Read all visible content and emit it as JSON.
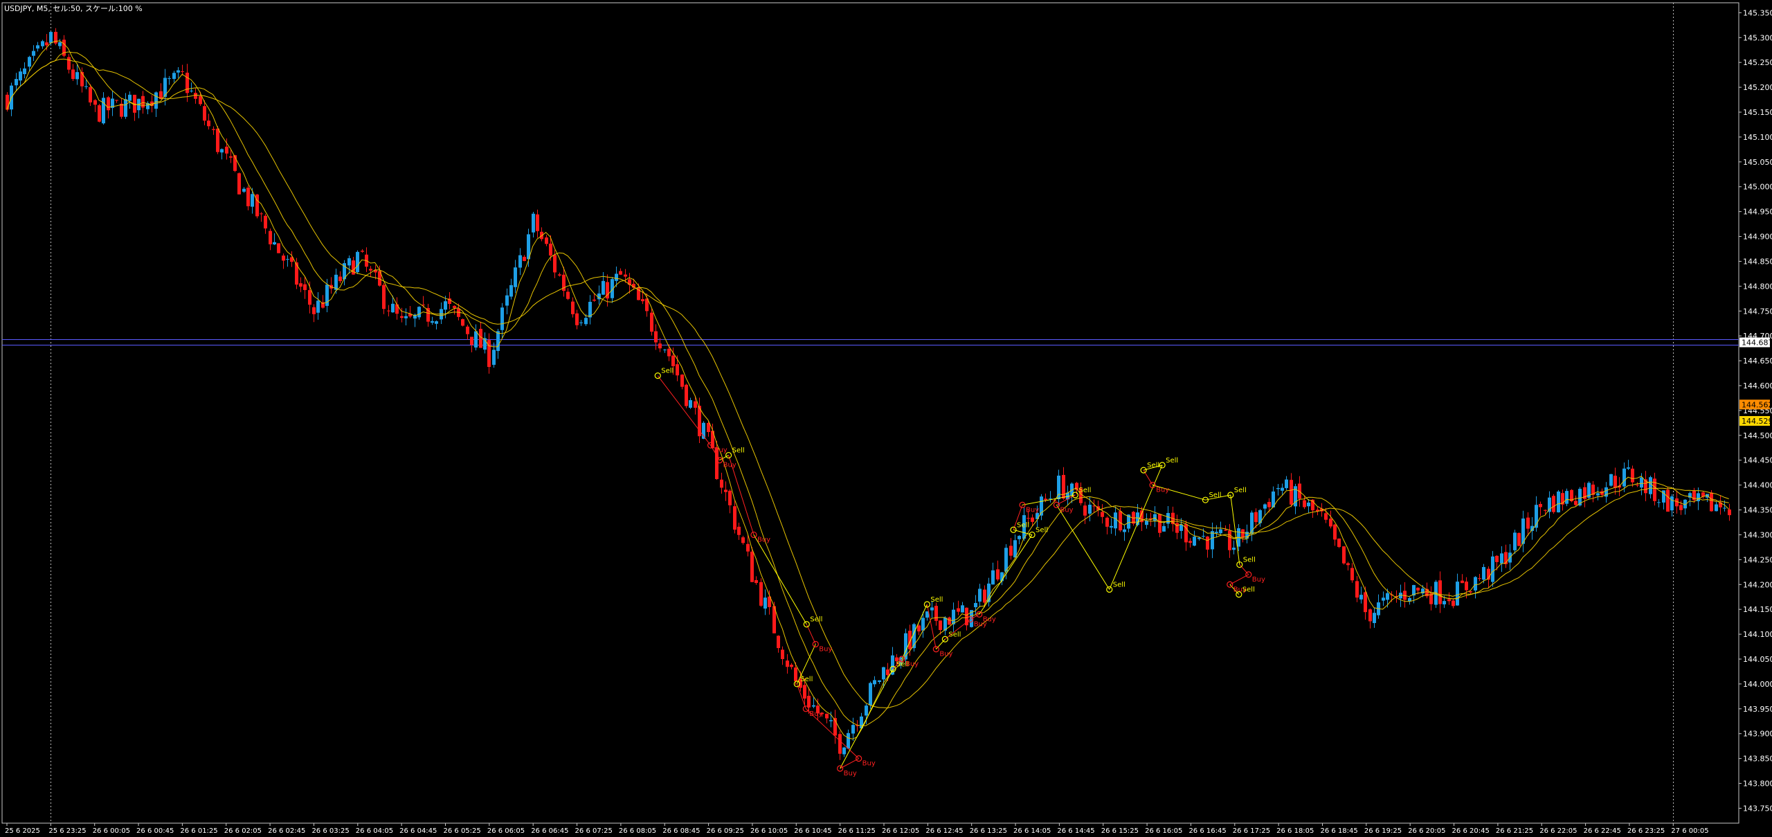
{
  "header": {
    "text": "USDJPY, M5, セル:50, スケール:100 %"
  },
  "colors": {
    "background": "#000000",
    "frame": "#c8c8c8",
    "bull": "#1e9fe6",
    "bear": "#ff1a1a",
    "ma": "#e6c300",
    "bid_line": "#5a5aff",
    "marker_sell": "#ffff00",
    "marker_buy": "#ff2020"
  },
  "price_labels": {
    "bid": "144.687",
    "level_a": "144.562",
    "level_b": "144.529"
  },
  "chart_data": {
    "type": "candlestick",
    "symbol": "USDJPY",
    "timeframe": "M5",
    "ylim": [
      143.72,
      145.37
    ],
    "yticks": [
      "145.350",
      "145.300",
      "145.250",
      "145.200",
      "145.150",
      "145.100",
      "145.050",
      "145.000",
      "144.950",
      "144.900",
      "144.850",
      "144.800",
      "144.750",
      "144.700",
      "144.650",
      "144.600",
      "144.550",
      "144.500",
      "144.450",
      "144.400",
      "144.350",
      "144.300",
      "144.250",
      "144.200",
      "144.150",
      "144.100",
      "144.050",
      "144.000",
      "143.950",
      "143.900",
      "143.850",
      "143.800",
      "143.750"
    ],
    "xticks": [
      "25 6 2025",
      "25 6 23:25",
      "26 6 00:05",
      "26 6 00:45",
      "26 6 01:25",
      "26 6 02:05",
      "26 6 02:45",
      "26 6 03:25",
      "26 6 04:05",
      "26 6 04:45",
      "26 6 05:25",
      "26 6 06:05",
      "26 6 06:45",
      "26 6 07:25",
      "26 6 08:05",
      "26 6 08:45",
      "26 6 09:25",
      "26 6 10:05",
      "26 6 10:45",
      "26 6 11:25",
      "26 6 12:05",
      "26 6 12:45",
      "26 6 13:25",
      "26 6 14:05",
      "26 6 14:45",
      "26 6 15:25",
      "26 6 16:05",
      "26 6 16:45",
      "26 6 17:25",
      "26 6 18:05",
      "26 6 18:45",
      "26 6 19:25",
      "26 6 20:05",
      "26 6 20:45",
      "26 6 21:25",
      "26 6 22:05",
      "26 6 22:45",
      "26 6 23:25",
      "27 6 00:05"
    ],
    "bid_price": 144.687,
    "levels": [
      144.562,
      144.529
    ],
    "period_separators": [
      "25 6 23:25",
      "27 6 00:05"
    ],
    "close_path": [
      [
        "25 6 2025",
        145.18
      ],
      [
        "25 6 23:25",
        145.3
      ],
      [
        "26 6 00:05",
        145.15
      ],
      [
        "26 6 00:45",
        145.17
      ],
      [
        "26 6 01:25",
        145.22
      ],
      [
        "26 6 02:05",
        145.05
      ],
      [
        "26 6 02:45",
        144.9
      ],
      [
        "26 6 03:25",
        144.75
      ],
      [
        "26 6 04:05",
        144.86
      ],
      [
        "26 6 04:45",
        144.72
      ],
      [
        "26 6 05:25",
        144.76
      ],
      [
        "26 6 06:05",
        144.66
      ],
      [
        "26 6 06:45",
        144.93
      ],
      [
        "26 6 07:25",
        144.74
      ],
      [
        "26 6 08:05",
        144.82
      ],
      [
        "26 6 08:45",
        144.68
      ],
      [
        "26 6 09:25",
        144.48
      ],
      [
        "26 6 10:05",
        144.22
      ],
      [
        "26 6 10:45",
        144.0
      ],
      [
        "26 6 11:25",
        143.88
      ],
      [
        "26 6 12:05",
        144.03
      ],
      [
        "26 6 12:45",
        144.13
      ],
      [
        "26 6 13:25",
        144.14
      ],
      [
        "26 6 14:05",
        144.3
      ],
      [
        "26 6 14:45",
        144.4
      ],
      [
        "26 6 15:25",
        144.33
      ],
      [
        "26 6 16:05",
        144.34
      ],
      [
        "26 6 16:45",
        144.3
      ],
      [
        "26 6 17:25",
        144.28
      ],
      [
        "26 6 18:05",
        144.4
      ],
      [
        "26 6 18:45",
        144.33
      ],
      [
        "26 6 19:25",
        144.14
      ],
      [
        "26 6 20:05",
        144.19
      ],
      [
        "26 6 20:45",
        144.18
      ],
      [
        "26 6 21:25",
        144.24
      ],
      [
        "26 6 22:05",
        144.36
      ],
      [
        "26 6 22:45",
        144.39
      ],
      [
        "26 6 23:25",
        144.42
      ],
      [
        "27 6 00:05",
        144.36
      ]
    ],
    "markers": [
      {
        "label": "Sell",
        "time": "26 6 08:45",
        "price": 144.62
      },
      {
        "label": "Buy",
        "time": "26 6 09:25",
        "price": 144.48
      },
      {
        "label": "Buy",
        "time": "26 6 09:25",
        "price": 144.45
      },
      {
        "label": "Sell",
        "time": "26 6 09:25",
        "price": 144.46
      },
      {
        "label": "Buy",
        "time": "26 6 10:05",
        "price": 144.3
      },
      {
        "label": "Sell",
        "time": "26 6 10:45",
        "price": 144.12
      },
      {
        "label": "Buy",
        "time": "26 6 10:45",
        "price": 144.08
      },
      {
        "label": "Sell",
        "time": "26 6 10:45",
        "price": 144.0
      },
      {
        "label": "Buy",
        "time": "26 6 10:45",
        "price": 143.95
      },
      {
        "label": "Buy",
        "time": "26 6 11:25",
        "price": 143.85
      },
      {
        "label": "Buy",
        "time": "26 6 11:25",
        "price": 143.83
      },
      {
        "label": "Sell",
        "time": "26 6 12:05",
        "price": 144.03
      },
      {
        "label": "Buy",
        "time": "26 6 12:05",
        "price": 144.05
      },
      {
        "label": "Sell",
        "time": "26 6 12:45",
        "price": 144.16
      },
      {
        "label": "Buy",
        "time": "26 6 12:45",
        "price": 144.07
      },
      {
        "label": "Sell",
        "time": "26 6 12:45",
        "price": 144.09
      },
      {
        "label": "Buy",
        "time": "26 6 13:25",
        "price": 144.13
      },
      {
        "label": "Buy",
        "time": "26 6 13:25",
        "price": 144.14
      },
      {
        "label": "Sell",
        "time": "26 6 14:05",
        "price": 144.3
      },
      {
        "label": "Sell",
        "time": "26 6 14:05",
        "price": 144.31
      },
      {
        "label": "Buy",
        "time": "26 6 14:05",
        "price": 144.36
      },
      {
        "label": "Sell",
        "time": "26 6 14:45",
        "price": 144.38
      },
      {
        "label": "Buy",
        "time": "26 6 14:45",
        "price": 144.36
      },
      {
        "label": "Sell",
        "time": "26 6 15:25",
        "price": 144.19
      },
      {
        "label": "Sell",
        "time": "26 6 16:05",
        "price": 144.44
      },
      {
        "label": "Sell",
        "time": "26 6 16:05",
        "price": 144.43
      },
      {
        "label": "Buy",
        "time": "26 6 16:05",
        "price": 144.4
      },
      {
        "label": "Sell",
        "time": "26 6 16:45",
        "price": 144.37
      },
      {
        "label": "Sell",
        "time": "26 6 17:25",
        "price": 144.38
      },
      {
        "label": "Sell",
        "time": "26 6 17:25",
        "price": 144.24
      },
      {
        "label": "Buy",
        "time": "26 6 17:25",
        "price": 144.22
      },
      {
        "label": "Buy",
        "time": "26 6 17:25",
        "price": 144.2
      },
      {
        "label": "Sell",
        "time": "26 6 17:25",
        "price": 144.18
      }
    ]
  }
}
